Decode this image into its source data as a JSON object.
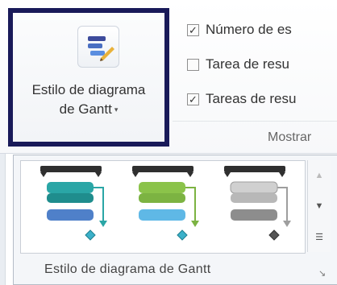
{
  "ribbon": {
    "gantt_style_button": {
      "label_line1": "Estilo de diagrama",
      "label_line2": "de Gantt",
      "icon": "gantt-style-icon",
      "caret": "▾"
    },
    "show_group": {
      "title": "Mostrar",
      "options": [
        {
          "label": "Número de es",
          "checked": true
        },
        {
          "label": "Tarea de resu",
          "checked": false
        },
        {
          "label": "Tareas de resu",
          "checked": true
        }
      ]
    }
  },
  "gallery": {
    "title": "Estilo de diagrama de Gantt",
    "styles": [
      {
        "name": "azul",
        "task_color": "#2aa6a6",
        "task_color2": "#4f80c9",
        "arrow_color": "#2aa6a6"
      },
      {
        "name": "verde",
        "task_color": "#8bc34a",
        "task_color2": "#5fb8e6",
        "arrow_color": "#7cb342"
      },
      {
        "name": "gris",
        "task_color": "#bdbdbd",
        "task_color2": "#8d8d8d",
        "arrow_color": "#9e9e9e"
      }
    ],
    "scroll_up": "▲",
    "scroll_down": "▼",
    "more": "☰",
    "launcher": "↘"
  }
}
